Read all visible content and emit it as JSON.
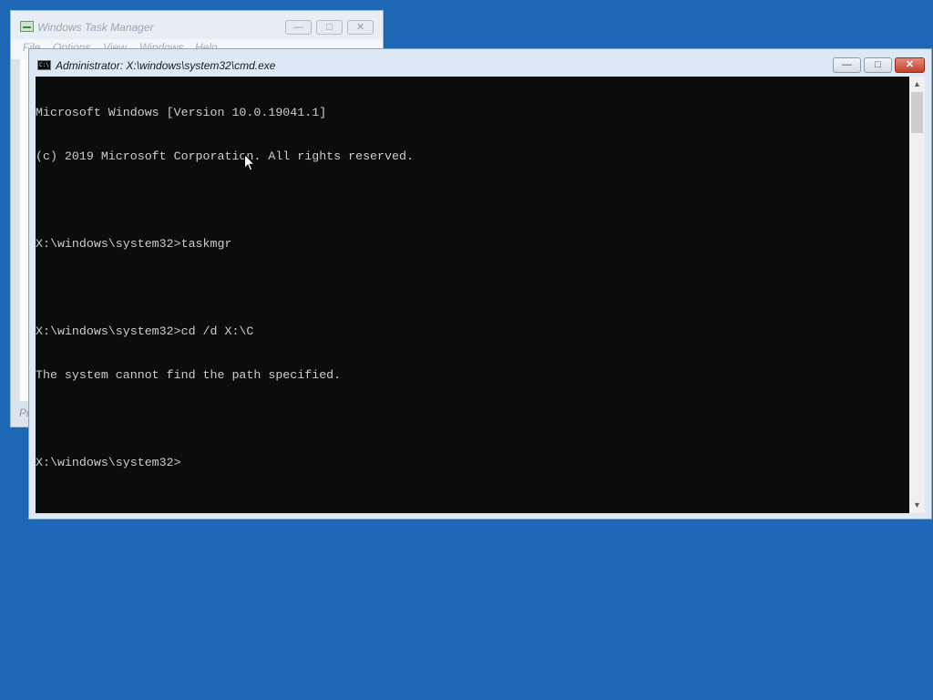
{
  "task_manager": {
    "title": "Windows Task Manager",
    "menu": [
      "File",
      "Options",
      "View",
      "Windows",
      "Help"
    ],
    "bottom_text": "Pr",
    "buttons": {
      "minimize": "—",
      "maximize": "□",
      "close": "✕"
    }
  },
  "cmd": {
    "title": "Administrator: X:\\windows\\system32\\cmd.exe",
    "icon_text": "C:\\",
    "buttons": {
      "minimize": "—",
      "maximize": "□",
      "close": "✕"
    },
    "lines": [
      "Microsoft Windows [Version 10.0.19041.1]",
      "(c) 2019 Microsoft Corporation. All rights reserved.",
      "",
      "X:\\windows\\system32>taskmgr",
      "",
      "X:\\windows\\system32>cd /d X:\\C",
      "The system cannot find the path specified.",
      "",
      "X:\\windows\\system32>"
    ],
    "scrollbar": {
      "up_arrow": "▲",
      "down_arrow": "▼"
    }
  },
  "icons": {
    "task_manager_icon": "task-manager-icon",
    "cmd_icon": "command-prompt-icon",
    "cursor": "mouse-pointer-icon"
  }
}
